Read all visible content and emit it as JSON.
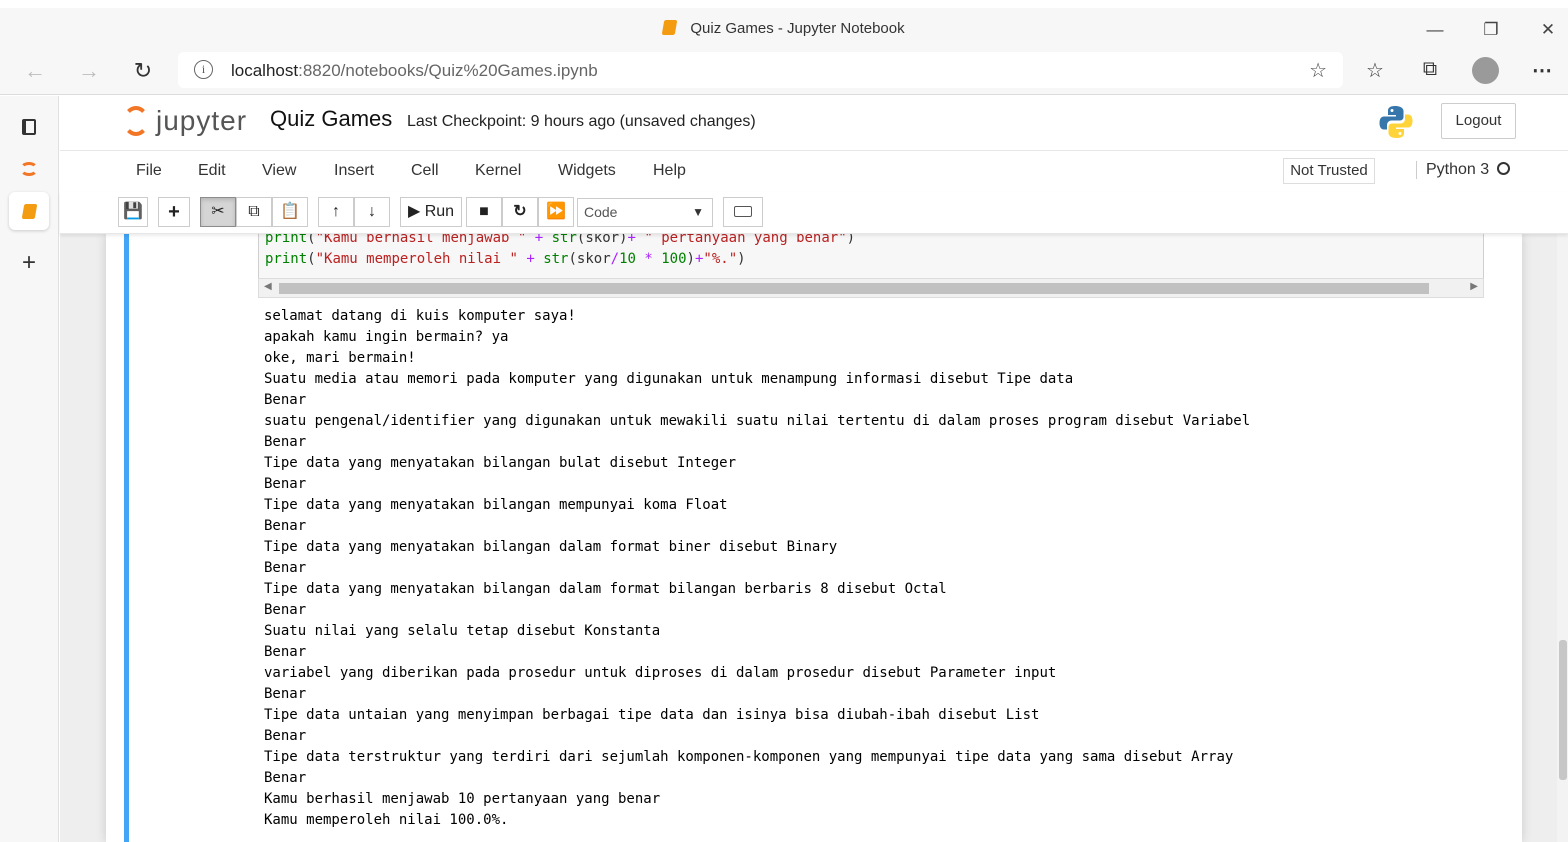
{
  "window": {
    "title": "Quiz Games - Jupyter Notebook"
  },
  "browser": {
    "url_host": "localhost",
    "url_rest": ":8820/notebooks/Quiz%20Games.ipynb"
  },
  "jupyter": {
    "logo_text": "jupyter",
    "notebook_name": "Quiz Games",
    "checkpoint": "Last Checkpoint: 9 hours ago  (unsaved changes)",
    "logout_label": "Logout",
    "not_trusted": "Not Trusted",
    "kernel": "Python 3"
  },
  "menu": {
    "items": [
      "File",
      "Edit",
      "View",
      "Insert",
      "Cell",
      "Kernel",
      "Widgets",
      "Help"
    ]
  },
  "toolbar": {
    "run_label": "Run",
    "cell_type": "Code"
  },
  "code": {
    "lines": [
      [
        {
          "t": "print",
          "c": "bi"
        },
        {
          "t": "(",
          "c": "p"
        },
        {
          "t": "\"Kamu berhasil menjawab \"",
          "c": "str"
        },
        {
          "t": " + ",
          "c": "op"
        },
        {
          "t": "str",
          "c": "bi"
        },
        {
          "t": "(skor)",
          "c": "p"
        },
        {
          "t": "+",
          "c": "op"
        },
        {
          "t": " \" pertanyaan yang benar\"",
          "c": "str"
        },
        {
          "t": ")",
          "c": "p"
        }
      ],
      [
        {
          "t": "print",
          "c": "bi"
        },
        {
          "t": "(",
          "c": "p"
        },
        {
          "t": "\"Kamu memperoleh nilai \"",
          "c": "str"
        },
        {
          "t": " + ",
          "c": "op"
        },
        {
          "t": "str",
          "c": "bi"
        },
        {
          "t": "(skor",
          "c": "p"
        },
        {
          "t": "/",
          "c": "op"
        },
        {
          "t": "10",
          "c": "num"
        },
        {
          "t": " * ",
          "c": "op"
        },
        {
          "t": "100",
          "c": "num"
        },
        {
          "t": ")",
          "c": "p"
        },
        {
          "t": "+",
          "c": "op"
        },
        {
          "t": "\"%.\"",
          "c": "str"
        },
        {
          "t": ")",
          "c": "p"
        }
      ]
    ]
  },
  "output": {
    "lines": [
      "selamat datang di kuis komputer saya!",
      "apakah kamu ingin bermain? ya",
      "oke, mari bermain!",
      "Suatu media atau memori pada komputer yang digunakan untuk menampung informasi disebut Tipe data",
      "Benar",
      "suatu pengenal/identifier yang digunakan untuk mewakili suatu nilai tertentu di dalam proses program disebut Variabel",
      "Benar",
      "Tipe data yang menyatakan bilangan bulat disebut Integer",
      "Benar",
      "Tipe data yang menyatakan bilangan mempunyai koma Float",
      "Benar",
      "Tipe data yang menyatakan bilangan dalam format biner disebut Binary",
      "Benar",
      "Tipe data yang menyatakan bilangan dalam format bilangan berbaris 8 disebut Octal",
      "Benar",
      "Suatu nilai yang selalu tetap disebut Konstanta",
      "Benar",
      "variabel yang diberikan pada prosedur untuk diproses di dalam prosedur disebut Parameter input",
      "Benar",
      "Tipe data untaian yang menyimpan berbagai tipe data dan isinya bisa diubah-ibah disebut List",
      "Benar",
      "Tipe data terstruktur yang terdiri dari sejumlah komponen-komponen yang mempunyai tipe data yang sama disebut Array",
      "Benar",
      "Kamu berhasil menjawab 10 pertanyaan yang benar",
      "Kamu memperoleh nilai 100.0%."
    ]
  }
}
